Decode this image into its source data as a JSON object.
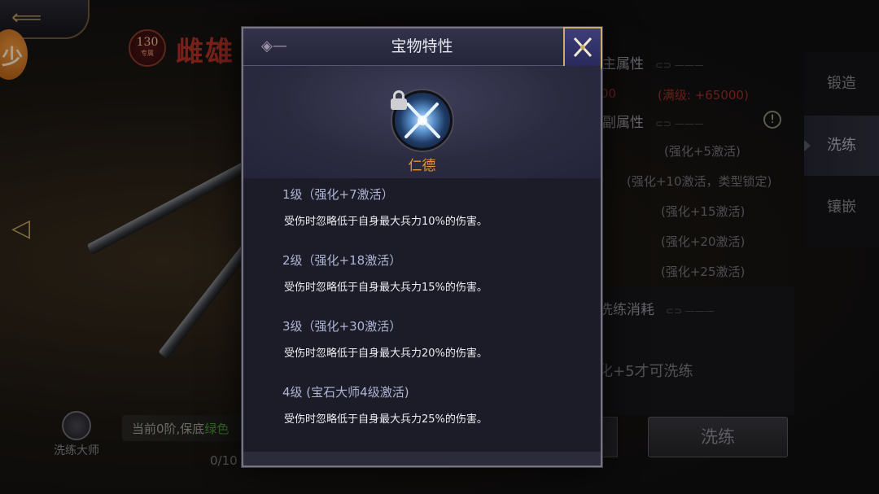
{
  "background": {
    "hero_level": "130",
    "hero_level_tag": "专属",
    "hero_title": "雌雄",
    "main_attr_label": "主属性",
    "main_attr_value_partial": "00",
    "main_attr_max": "(满级: +65000)",
    "sub_attr_label": "副属性",
    "sub_attr_lines": [
      "(强化+5激活)",
      "(强化+10激活，类型锁定)",
      "(强化+15激活)",
      "(强化+20激活)",
      "(强化+25激活)"
    ],
    "cost_label": "洗练消耗",
    "unlock_note": "化+5才可洗练",
    "wash_button": "洗练",
    "master_label": "洗练大师",
    "stage_text": "当前0阶,保底",
    "stage_green": "绿色",
    "progress_text": "0/10",
    "tabs": [
      "锻造",
      "洗练",
      "镶嵌"
    ]
  },
  "modal": {
    "title": "宝物特性",
    "skill_name": "仁德",
    "levels": [
      {
        "title": "1级（强化+7激活）",
        "desc": "受伤时忽略低于自身最大兵力10%的伤害。"
      },
      {
        "title": "2级（强化+18激活）",
        "desc": "受伤时忽略低于自身最大兵力15%的伤害。"
      },
      {
        "title": "3级（强化+30激活）",
        "desc": "受伤时忽略低于自身最大兵力20%的伤害。"
      },
      {
        "title": "4级 (宝石大师4级激活)",
        "desc": "受伤时忽略低于自身最大兵力25%的伤害。"
      }
    ]
  },
  "colors": {
    "accent_orange": "#e6913e",
    "level_title": "#aeb4d4",
    "red_stat": "#a22e29",
    "gold_frame": "#c7ac6a"
  }
}
